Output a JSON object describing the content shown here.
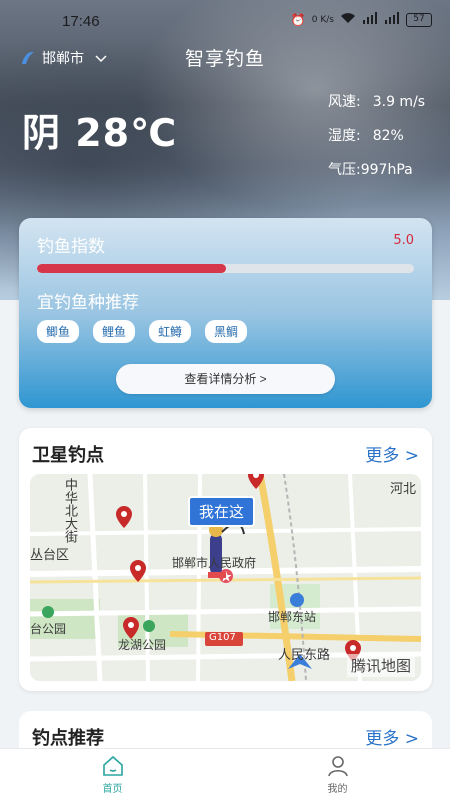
{
  "status_bar": {
    "time": "17:46",
    "net_speed": "0 K/s",
    "signal": "4G",
    "battery": "57"
  },
  "header": {
    "location": "邯郸市",
    "title": "智享钓鱼"
  },
  "weather": {
    "condition_temp": "阴 28℃",
    "wind_label": "风速:",
    "wind_value": "3.9 m/s",
    "humidity_label": "湿度:",
    "humidity_value": "82%",
    "pressure_label": "气压:",
    "pressure_value": "997hPa"
  },
  "fishing": {
    "index_label": "钓鱼指数",
    "index_value": "5.0",
    "index_fraction": 0.5,
    "recommend_label": "宜钓鱼种推荐",
    "species": [
      "鲫鱼",
      "鲤鱼",
      "虹鳟",
      "黑鲷"
    ],
    "detail_button": "查看详情分析 >"
  },
  "satellite": {
    "title": "卫星钓点",
    "more": "更多 >",
    "here_label": "我在这",
    "map_labels": {
      "street": "中华北大街",
      "district": "丛台区",
      "gov": "邯郸市人民政府",
      "park1": "台公园",
      "park2": "龙湖公园",
      "road": "G107",
      "station": "邯郸东站",
      "road2": "人民东路",
      "north": "河北"
    },
    "map_brand": "腾讯地图"
  },
  "recommend_spots": {
    "title": "钓点推荐",
    "more": "更多 >"
  },
  "nav": {
    "home": "首页",
    "mine": "我的"
  },
  "colors": {
    "accent": "#2b73c8",
    "index_bar": "#d6374a",
    "nav_active": "#2aa5a0"
  }
}
